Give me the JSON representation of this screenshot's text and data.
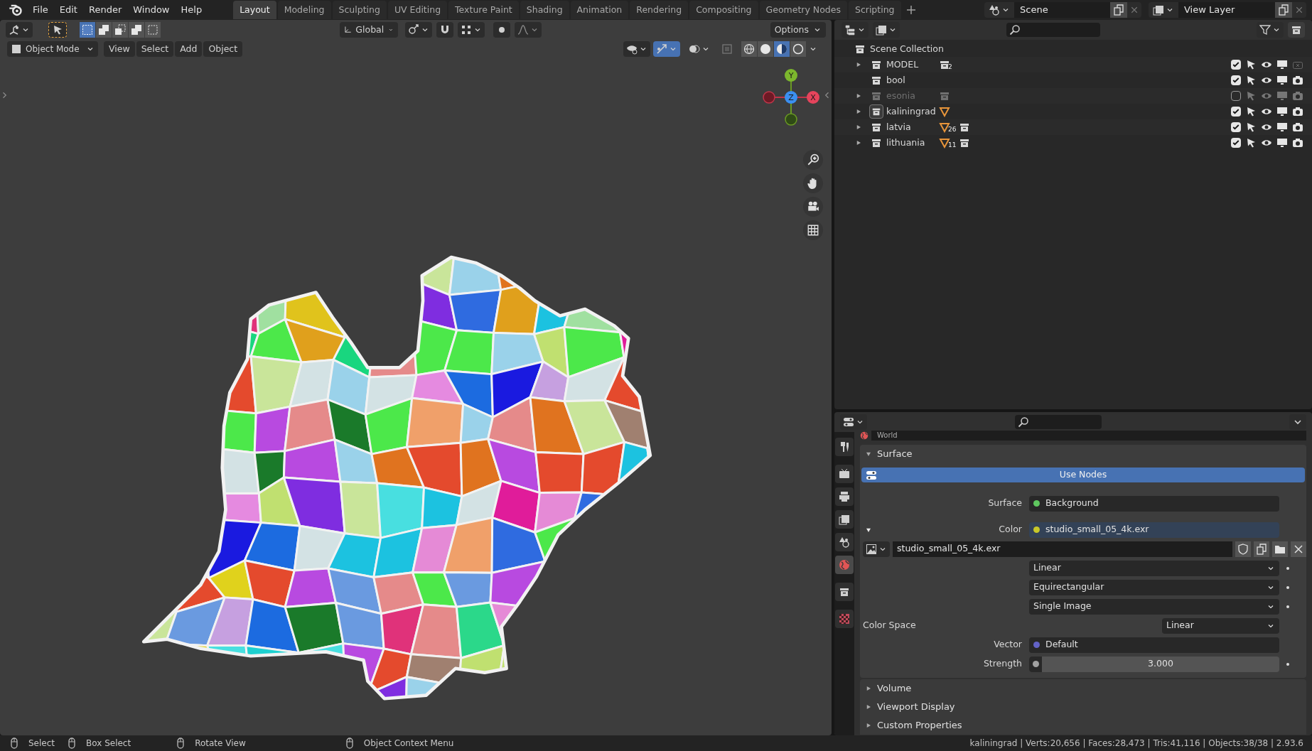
{
  "menu": [
    "File",
    "Edit",
    "Render",
    "Window",
    "Help"
  ],
  "workspaces": [
    {
      "label": "Layout",
      "selected": true
    },
    {
      "label": "Modeling",
      "selected": false
    },
    {
      "label": "Sculpting",
      "selected": false
    },
    {
      "label": "UV Editing",
      "selected": false
    },
    {
      "label": "Texture Paint",
      "selected": false
    },
    {
      "label": "Shading",
      "selected": false
    },
    {
      "label": "Animation",
      "selected": false
    },
    {
      "label": "Rendering",
      "selected": false
    },
    {
      "label": "Compositing",
      "selected": false
    },
    {
      "label": "Geometry Nodes",
      "selected": false
    },
    {
      "label": "Scripting",
      "selected": false
    }
  ],
  "scene": {
    "name": "Scene"
  },
  "view_layer": {
    "name": "View Layer"
  },
  "viewport": {
    "orientation": "Global",
    "options": "Options",
    "mode": "Object Mode",
    "menus": [
      "View",
      "Select",
      "Add",
      "Object"
    ],
    "select_modes": [
      {
        "selected": true
      },
      {
        "selected": false
      },
      {
        "selected": false
      },
      {
        "selected": false
      },
      {
        "selected": false
      }
    ],
    "shading": [
      {
        "kind": "wireframe",
        "selected": false
      },
      {
        "kind": "solid",
        "selected": false
      },
      {
        "kind": "material",
        "selected": true
      },
      {
        "kind": "rendered",
        "selected": false
      }
    ],
    "gizmo": {
      "y": "Y",
      "z": "Z",
      "x": "X"
    }
  },
  "outliner": {
    "root": "Scene Collection",
    "collections": [
      {
        "name": "MODEL",
        "expandable": true,
        "checked": true,
        "active": false,
        "renderable": false,
        "badges": [
          {
            "kind": "collection",
            "count": "2"
          }
        ]
      },
      {
        "name": "bool",
        "expandable": false,
        "checked": true,
        "active": false,
        "renderable": true
      },
      {
        "name": "esonia",
        "expandable": true,
        "checked": false,
        "active": false,
        "renderable": true,
        "badges": [
          {
            "kind": "collection"
          }
        ]
      },
      {
        "name": "kaliningrad",
        "expandable": true,
        "checked": true,
        "active": true,
        "renderable": true,
        "badges": [
          {
            "kind": "mesh"
          }
        ]
      },
      {
        "name": "latvia",
        "expandable": true,
        "checked": true,
        "active": false,
        "renderable": true,
        "badges": [
          {
            "kind": "mesh",
            "count": "26"
          },
          {
            "kind": "collection"
          }
        ]
      },
      {
        "name": "lithuania",
        "expandable": true,
        "checked": true,
        "active": false,
        "renderable": true,
        "badges": [
          {
            "kind": "mesh",
            "count": "11"
          },
          {
            "kind": "collection"
          }
        ]
      }
    ]
  },
  "properties": {
    "tabs": [
      {
        "kind": "tool",
        "selected": false
      },
      {
        "kind": "render",
        "selected": false
      },
      {
        "kind": "output",
        "selected": false
      },
      {
        "kind": "view_layer",
        "selected": false
      },
      {
        "kind": "scene",
        "selected": false
      },
      {
        "kind": "world",
        "selected": true
      },
      {
        "kind": "collection",
        "selected": false
      },
      {
        "kind": "texture",
        "selected": false
      }
    ],
    "world": "World",
    "surface_panel": {
      "title": "Surface",
      "expanded": true,
      "use_nodes": "Use Nodes",
      "inputs": [
        {
          "kind": "socket",
          "label": "Surface",
          "value": "Background",
          "color": "#5fc75f"
        },
        {
          "kind": "socket",
          "label": "Color",
          "value": "studio_small_05_4k.exr",
          "color": "#c7c729",
          "expanded": true
        },
        {
          "kind": "image",
          "value": "studio_small_05_4k.exr"
        },
        {
          "kind": "dropdown",
          "value": "Linear"
        },
        {
          "kind": "dropdown",
          "value": "Equirectangular"
        },
        {
          "kind": "dropdown",
          "value": "Single Image"
        },
        {
          "kind": "labeled_dropdown",
          "label": "Color Space",
          "value": "Linear"
        },
        {
          "kind": "socket",
          "label": "Vector",
          "value": "Default",
          "color": "#6363c7"
        },
        {
          "kind": "number",
          "label": "Strength",
          "value": "3.000",
          "color": "#a1a1a1"
        }
      ]
    },
    "collapsed_panels": [
      {
        "title": "Volume",
        "expanded": false
      },
      {
        "title": "Viewport Display",
        "expanded": false
      },
      {
        "title": "Custom Properties",
        "expanded": false
      }
    ]
  },
  "status": {
    "hints": [
      {
        "kind": "left",
        "label": "Select"
      },
      {
        "kind": "drag",
        "label": "Box Select"
      },
      {
        "kind": "middle",
        "label": "Rotate View"
      },
      {
        "kind": "right",
        "label": "Object Context Menu"
      }
    ],
    "stats": "kaliningrad | Verts:20,656 | Faces:28,473 | Tris:41,116 | Objects:38/38 | 2.93.6"
  }
}
